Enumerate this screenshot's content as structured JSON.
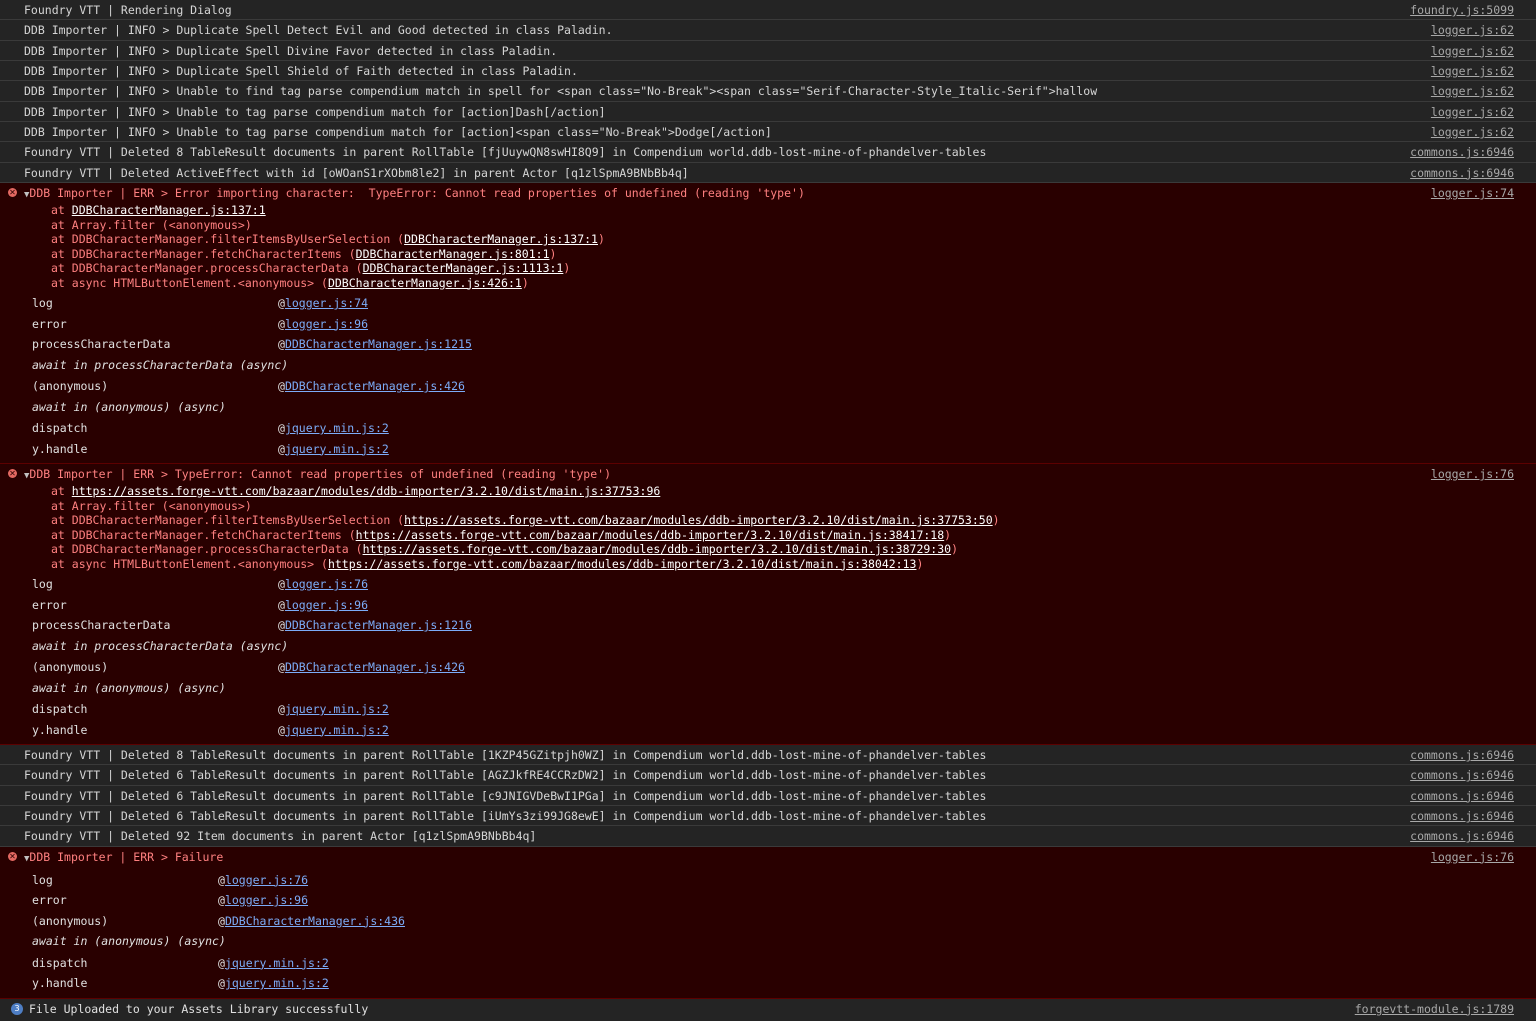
{
  "console": {
    "top_rows": [
      {
        "text": "Foundry VTT | Rendering Dialog",
        "source": "foundry.js:5099"
      },
      {
        "text": "DDB Importer | INFO > Duplicate Spell Detect Evil and Good detected in class Paladin.",
        "source": "logger.js:62"
      },
      {
        "text": "DDB Importer | INFO > Duplicate Spell Divine Favor detected in class Paladin.",
        "source": "logger.js:62"
      },
      {
        "text": "DDB Importer | INFO > Duplicate Spell Shield of Faith detected in class Paladin.",
        "source": "logger.js:62"
      },
      {
        "text": "DDB Importer | INFO > Unable to find tag parse compendium match in spell for <span class=\"No-Break\"><span class=\"Serif-Character-Style_Italic-Serif\">hallow",
        "source": "logger.js:62"
      },
      {
        "text": "DDB Importer | INFO > Unable to tag parse compendium match for [action]Dash[/action]",
        "source": "logger.js:62"
      },
      {
        "text": "DDB Importer | INFO > Unable to tag parse compendium match for [action]<span class=\"No-Break\">Dodge[/action]",
        "source": "logger.js:62"
      },
      {
        "text": "Foundry VTT | Deleted 8 TableResult documents in parent RollTable [fjUuywQN8swHI8Q9] in Compendium world.ddb-lost-mine-of-phandelver-tables",
        "source": "commons.js:6946"
      },
      {
        "text": "Foundry VTT | Deleted ActiveEffect with id [oWOanS1rXObm8le2] in parent Actor [q1zlSpmA9BNbBb4q]",
        "source": "commons.js:6946"
      }
    ],
    "error1": {
      "message": "DDB Importer | ERR > Error importing character:  TypeError: Cannot read properties of undefined (reading 'type')",
      "source": "logger.js:74",
      "stack": [
        {
          "prefix": "at ",
          "link": "DDBCharacterManager.js:137:1",
          "suffix": ""
        },
        {
          "prefix": "at Array.filter (<anonymous>)",
          "link": "",
          "suffix": ""
        },
        {
          "prefix": "at DDBCharacterManager.filterItemsByUserSelection (",
          "link": "DDBCharacterManager.js:137:1",
          "suffix": ")"
        },
        {
          "prefix": "at DDBCharacterManager.fetchCharacterItems (",
          "link": "DDBCharacterManager.js:801:1",
          "suffix": ")"
        },
        {
          "prefix": "at DDBCharacterManager.processCharacterData (",
          "link": "DDBCharacterManager.js:1113:1",
          "suffix": ")"
        },
        {
          "prefix": "at async HTMLButtonElement.<anonymous> (",
          "link": "DDBCharacterManager.js:426:1",
          "suffix": ")"
        }
      ],
      "frames": [
        {
          "name": "log",
          "link": "logger.js:74"
        },
        {
          "name": "error",
          "link": "logger.js:96"
        },
        {
          "name": "processCharacterData",
          "link": "DDBCharacterManager.js:1215"
        },
        {
          "name": "await in processCharacterData (async)",
          "link": ""
        },
        {
          "name": "(anonymous)",
          "link": "DDBCharacterManager.js:426"
        },
        {
          "name": "await in (anonymous) (async)",
          "link": ""
        },
        {
          "name": "dispatch",
          "link": "jquery.min.js:2"
        },
        {
          "name": "y.handle",
          "link": "jquery.min.js:2"
        }
      ]
    },
    "error2": {
      "message": "DDB Importer | ERR > TypeError: Cannot read properties of undefined (reading 'type')",
      "source": "logger.js:76",
      "stack": [
        {
          "prefix": "at ",
          "link": "https://assets.forge-vtt.com/bazaar/modules/ddb-importer/3.2.10/dist/main.js:37753:96",
          "suffix": ""
        },
        {
          "prefix": "at Array.filter (<anonymous>)",
          "link": "",
          "suffix": ""
        },
        {
          "prefix": "at DDBCharacterManager.filterItemsByUserSelection (",
          "link": "https://assets.forge-vtt.com/bazaar/modules/ddb-importer/3.2.10/dist/main.js:37753:50",
          "suffix": ")"
        },
        {
          "prefix": "at DDBCharacterManager.fetchCharacterItems (",
          "link": "https://assets.forge-vtt.com/bazaar/modules/ddb-importer/3.2.10/dist/main.js:38417:18",
          "suffix": ")"
        },
        {
          "prefix": "at DDBCharacterManager.processCharacterData (",
          "link": "https://assets.forge-vtt.com/bazaar/modules/ddb-importer/3.2.10/dist/main.js:38729:30",
          "suffix": ")"
        },
        {
          "prefix": "at async HTMLButtonElement.<anonymous> (",
          "link": "https://assets.forge-vtt.com/bazaar/modules/ddb-importer/3.2.10/dist/main.js:38042:13",
          "suffix": ")"
        }
      ],
      "frames": [
        {
          "name": "log",
          "link": "logger.js:76"
        },
        {
          "name": "error",
          "link": "logger.js:96"
        },
        {
          "name": "processCharacterData",
          "link": "DDBCharacterManager.js:1216"
        },
        {
          "name": "await in processCharacterData (async)",
          "link": ""
        },
        {
          "name": "(anonymous)",
          "link": "DDBCharacterManager.js:426"
        },
        {
          "name": "await in (anonymous) (async)",
          "link": ""
        },
        {
          "name": "dispatch",
          "link": "jquery.min.js:2"
        },
        {
          "name": "y.handle",
          "link": "jquery.min.js:2"
        }
      ]
    },
    "middle_rows": [
      {
        "text": "Foundry VTT | Deleted 8 TableResult documents in parent RollTable [1KZP45GZitpjh0WZ] in Compendium world.ddb-lost-mine-of-phandelver-tables",
        "source": "commons.js:6946"
      },
      {
        "text": "Foundry VTT | Deleted 6 TableResult documents in parent RollTable [AGZJkfRE4CCRzDW2] in Compendium world.ddb-lost-mine-of-phandelver-tables",
        "source": "commons.js:6946"
      },
      {
        "text": "Foundry VTT | Deleted 6 TableResult documents in parent RollTable [c9JNIGVDeBwI1PGa] in Compendium world.ddb-lost-mine-of-phandelver-tables",
        "source": "commons.js:6946"
      },
      {
        "text": "Foundry VTT | Deleted 6 TableResult documents in parent RollTable [iUmYs3zi99JG8ewE] in Compendium world.ddb-lost-mine-of-phandelver-tables",
        "source": "commons.js:6946"
      },
      {
        "text": "Foundry VTT | Deleted 92 Item documents in parent Actor [q1zlSpmA9BNbBb4q]",
        "source": "commons.js:6946"
      }
    ],
    "error3": {
      "message": "DDB Importer | ERR > Failure",
      "source": "logger.js:76",
      "stack": [],
      "frames": [
        {
          "name": "log",
          "link": "logger.js:76"
        },
        {
          "name": "error",
          "link": "logger.js:96"
        },
        {
          "name": "(anonymous)",
          "link": "DDBCharacterManager.js:436"
        },
        {
          "name": "await in (anonymous) (async)",
          "link": ""
        },
        {
          "name": "dispatch",
          "link": "jquery.min.js:2"
        },
        {
          "name": "y.handle",
          "link": "jquery.min.js:2"
        }
      ]
    },
    "last_row": {
      "count": "3",
      "text": "File Uploaded to your Assets Library successfully",
      "source": "forgevtt-module.js:1789"
    },
    "expand_glyph": "▼",
    "error_glyph": "✕",
    "at_glyph": "@"
  }
}
